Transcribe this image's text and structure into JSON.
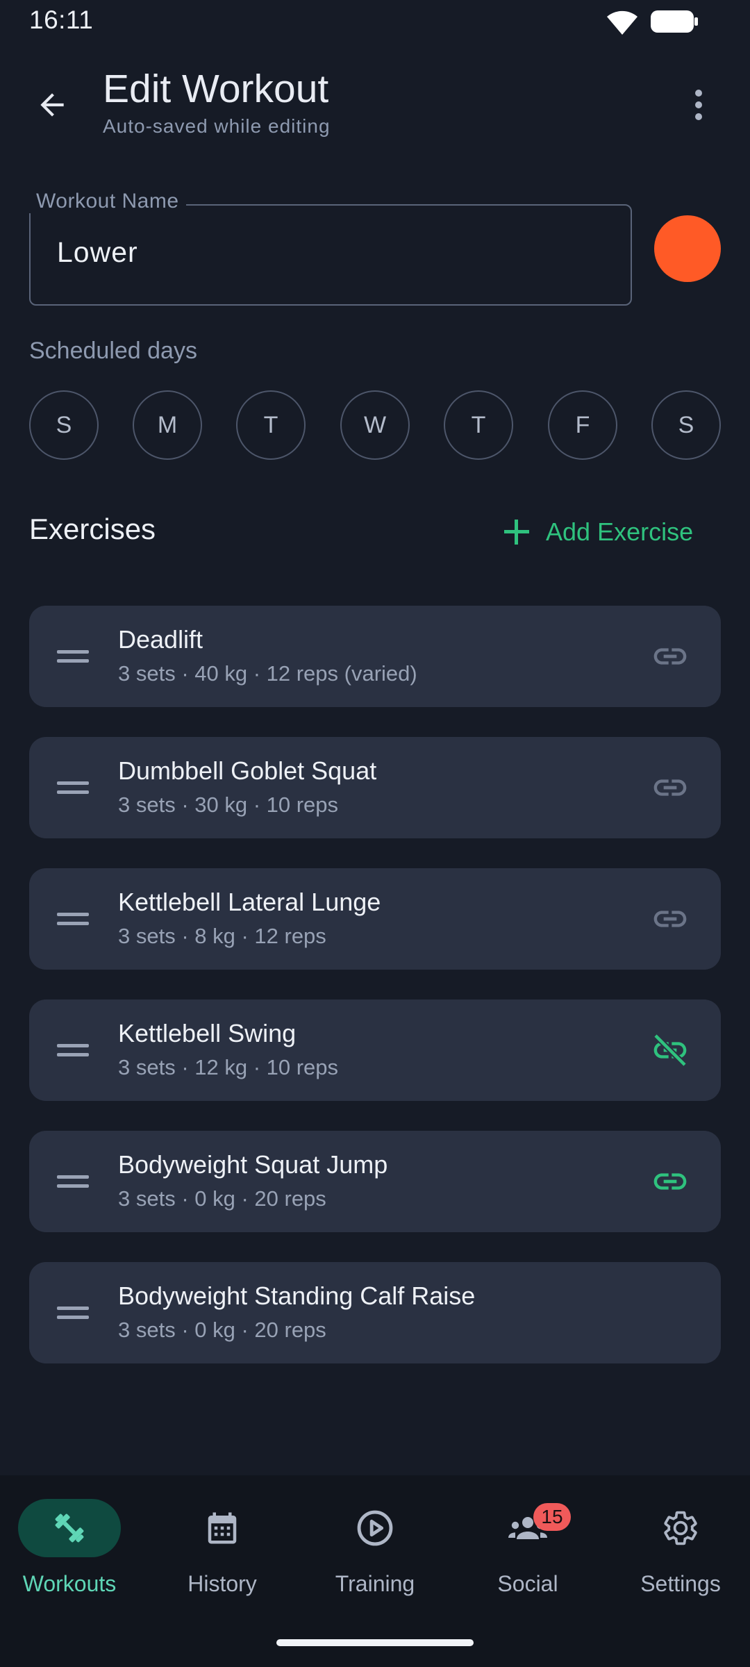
{
  "status_bar": {
    "time": "16:11"
  },
  "header": {
    "title": "Edit Workout",
    "subtitle": "Auto-saved while editing",
    "back_icon": "arrow-left-icon",
    "menu_icon": "more-vertical-icon"
  },
  "workout_name": {
    "label": "Workout Name",
    "value": "Lower",
    "color": "#ff5a26"
  },
  "scheduled_days": {
    "label": "Scheduled days",
    "days": [
      "S",
      "M",
      "T",
      "W",
      "T",
      "F",
      "S"
    ]
  },
  "exercises": {
    "title": "Exercises",
    "add_label": "Add Exercise",
    "items": [
      {
        "name": "Deadlift",
        "detail": "3 sets · 40 kg · 12 reps (varied)",
        "link": "link"
      },
      {
        "name": "Dumbbell Goblet Squat",
        "detail": "3 sets · 30 kg · 10 reps",
        "link": "link"
      },
      {
        "name": "Kettlebell Lateral Lunge",
        "detail": "3 sets · 8 kg · 12 reps",
        "link": "link"
      },
      {
        "name": "Kettlebell Swing",
        "detail": "3 sets · 12 kg · 10 reps",
        "link": "unlink-active"
      },
      {
        "name": "Bodyweight Squat Jump",
        "detail": "3 sets · 0 kg · 20 reps",
        "link": "link-active"
      },
      {
        "name": "Bodyweight Standing Calf Raise",
        "detail": "3 sets · 0 kg · 20 reps",
        "link": "none"
      }
    ]
  },
  "bottom_nav": {
    "items": [
      {
        "label": "Workouts",
        "icon": "dumbbell-icon",
        "active": true
      },
      {
        "label": "History",
        "icon": "calendar-icon",
        "active": false
      },
      {
        "label": "Training",
        "icon": "play-circle-icon",
        "active": false
      },
      {
        "label": "Social",
        "icon": "group-icon",
        "active": false,
        "badge": "15"
      },
      {
        "label": "Settings",
        "icon": "gear-icon",
        "active": false
      }
    ]
  },
  "colors": {
    "background": "#161b26",
    "card": "#2a3142",
    "accent_green": "#2fc27e",
    "active_pill": "#0f4a40",
    "active_label": "#5fd6b6",
    "badge": "#f05a5a",
    "muted_icon": "#6b7488"
  }
}
